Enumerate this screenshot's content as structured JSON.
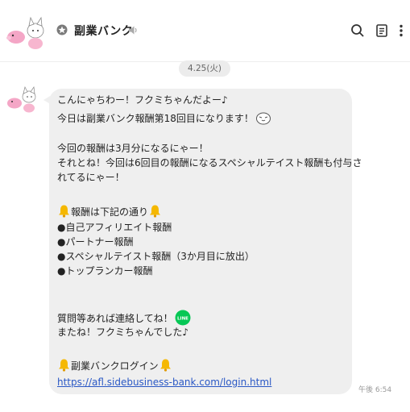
{
  "header": {
    "title": "副業バンク",
    "search_icon": "search-icon",
    "notes_icon": "notes-icon",
    "menu_icon": "more-vertical-icon"
  },
  "date_label": "4.25(火)",
  "message": {
    "lines": [
      "こんにゃちわー！フクミちゃんだよー♪",
      "今日は副業バンク報酬第18回目になります！",
      "",
      "今回の報酬は3月分になるにゃー！",
      "それとね！今回は6回目の報酬になるスペシャルテイスト報酬も付与さ",
      "れてるにゃー！",
      "",
      "報酬は下記の通り",
      "●自己アフィリエイト報酬",
      "●パートナー報酬",
      "●スペシャルテイスト報酬（3か月目に放出）",
      "●トップランカー報酬",
      "",
      "",
      "質問等あれば連絡してね！",
      "またね！フクミちゃんでした♪",
      "",
      "副業バンクログイン"
    ],
    "line_badge_text": "LINE",
    "link": "https://afl.sidebusiness-bank.com/login.html",
    "time": "午後 6:54"
  },
  "colors": {
    "bubble": "#efefef",
    "link": "#2a58c5",
    "line_green": "#06c755",
    "bell": "#f5b800"
  }
}
